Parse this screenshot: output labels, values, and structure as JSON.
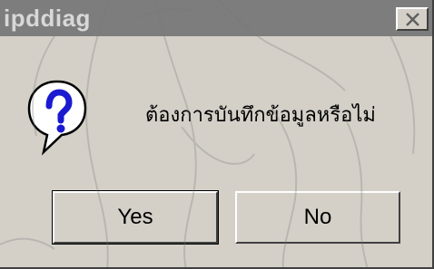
{
  "dialog": {
    "title": "ipddiag",
    "message": "ต้องการบันทึกข้อมูลหรือไม่",
    "icon": "question-icon",
    "buttons": {
      "yes_label": "Yes",
      "no_label": "No"
    },
    "close_icon": "close-icon"
  },
  "colors": {
    "titlebar_inactive": "#7d7d7d",
    "face": "#d4d0c8",
    "icon_blue": "#1a1ad0"
  }
}
